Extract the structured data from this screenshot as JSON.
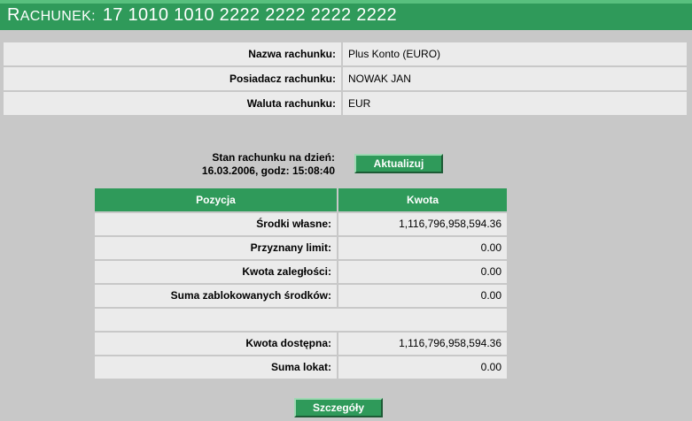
{
  "header": {
    "title_cap": "R",
    "title_rest": "ACHUNEK:",
    "account_number": "17 1010 1010 2222 2222 2222 2222"
  },
  "info": [
    {
      "label": "Nazwa rachunku:",
      "value": "Plus Konto (EURO)"
    },
    {
      "label": "Posiadacz rachunku:",
      "value": "NOWAK JAN"
    },
    {
      "label": "Waluta rachunku:",
      "value": "EUR"
    }
  ],
  "status": {
    "line1": "Stan rachunku na dzień:",
    "line2": "16.03.2006, godz: 15:08:40",
    "update_button": "Aktualizuj"
  },
  "balance_table": {
    "headers": [
      "Pozycja",
      "Kwota"
    ],
    "rows": [
      {
        "label": "Środki własne:",
        "value": "1,116,796,958,594.36"
      },
      {
        "label": "Przyznany limit:",
        "value": "0.00"
      },
      {
        "label": "Kwota zaległości:",
        "value": "0.00"
      },
      {
        "label": "Suma zablokowanych środków:",
        "value": "0.00"
      },
      {
        "label": "",
        "value": ""
      },
      {
        "label": "Kwota dostępna:",
        "value": "1,116,796,958,594.36"
      },
      {
        "label": "Suma lokat:",
        "value": "0.00"
      }
    ]
  },
  "details_button": "Szczegóły",
  "colors": {
    "header_green": "#2f9a5a",
    "background": "#c8c8c8",
    "row_background": "#ebebeb"
  }
}
